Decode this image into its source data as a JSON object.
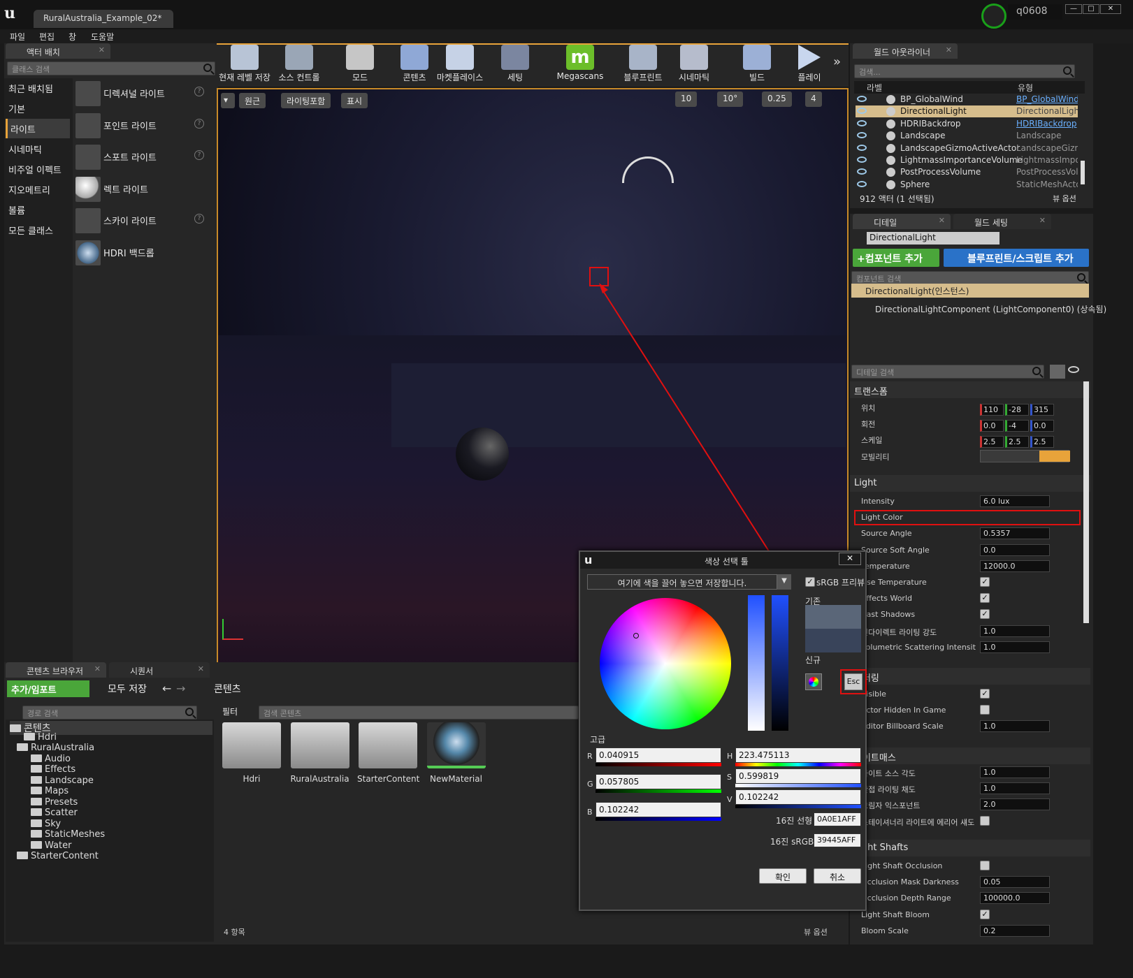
{
  "titlebar": {
    "tab": "RuralAustralia_Example_02*",
    "user": "q0608"
  },
  "menu": [
    "파일",
    "편집",
    "창",
    "도움말"
  ],
  "place_actors": {
    "tab": "액터 배치",
    "search_placeholder": "클래스 검색",
    "categories": [
      "최근 배치됨",
      "기본",
      "라이트",
      "시네마틱",
      "비주얼 이펙트",
      "지오메트리",
      "볼륨",
      "모든 클래스"
    ],
    "items": [
      "디렉셔널 라이트",
      "포인트 라이트",
      "스포트 라이트",
      "렉트 라이트",
      "스카이 라이트",
      "HDRI 백드롭"
    ]
  },
  "toolbar": [
    "현재 레벨 저장",
    "소스 컨트롤",
    "모드",
    "콘텐츠",
    "마켓플레이스",
    "세팅",
    "Megascans",
    "블루프린트",
    "시네마틱",
    "빌드",
    "플레이"
  ],
  "viewport": {
    "perspective": "원근",
    "lighting": "라이팅포함",
    "show": "표시",
    "grid": "10",
    "rot": "10°",
    "scale": "0.25",
    "cam": "4"
  },
  "outliner": {
    "tab": "월드 아웃라이너",
    "search_placeholder": "검색...",
    "col_label": "라벨",
    "col_type": "유형",
    "rows": [
      {
        "name": "BP_GlobalWind",
        "type": "BP_GlobalWind"
      },
      {
        "name": "DirectionalLight",
        "type": "DirectionalLight"
      },
      {
        "name": "HDRIBackdrop",
        "type": "HDRIBackdrop"
      },
      {
        "name": "Landscape",
        "type": "Landscape"
      },
      {
        "name": "LandscapeGizmoActiveActor",
        "type": "LandscapeGizmo"
      },
      {
        "name": "LightmassImportanceVolume",
        "type": "LightmassImporta"
      },
      {
        "name": "PostProcessVolume",
        "type": "PostProcessVolu"
      },
      {
        "name": "Sphere",
        "type": "StaticMeshActor"
      }
    ],
    "count": "912 액터 (1 선택됨)",
    "view_options": "뷰 옵션"
  },
  "details": {
    "tab": "디테일",
    "tab2": "월드 세팅",
    "actor_name": "DirectionalLight",
    "add_component": "+컴포넌트 추가",
    "add_bp": "블루프린트/스크립트 추가",
    "comp_search": "컴포넌트 검색",
    "instance": "DirectionalLight(인스턴스)",
    "component": "DirectionalLightComponent (LightComponent0) (상속됨)",
    "detail_search": "디테일 검색",
    "transform": "트랜스폼",
    "pos_label": "위치",
    "rot_label": "회전",
    "scale_label": "스케일",
    "mobility_label": "모빌리티",
    "pos": [
      "110",
      "-28",
      "315"
    ],
    "rot": [
      "0.0",
      "-4",
      "0.0"
    ],
    "scale": [
      "2.5",
      "2.5",
      "2.5"
    ],
    "light_section": "Light",
    "light_rows": [
      {
        "label": "Intensity",
        "value": "6.0 lux"
      },
      {
        "label": "Light Color",
        "value": ""
      },
      {
        "label": "Source Angle",
        "value": "0.5357"
      },
      {
        "label": "Source Soft Angle",
        "value": "0.0"
      },
      {
        "label": "Temperature",
        "value": "12000.0"
      },
      {
        "label": "Use Temperature",
        "value": ""
      },
      {
        "label": "Affects World",
        "value": ""
      },
      {
        "label": "Cast Shadows",
        "value": ""
      },
      {
        "label": "인다이렉트 라이팅 강도",
        "value": "1.0"
      },
      {
        "label": "Volumetric Scattering Intensity",
        "value": "1.0"
      }
    ],
    "render_section": "렌더링",
    "render_rows": [
      {
        "label": "Visible",
        "value": ""
      },
      {
        "label": "Actor Hidden In Game",
        "value": ""
      },
      {
        "label": "Editor Billboard Scale",
        "value": "1.0"
      }
    ],
    "lightmass_section": "라이트매스",
    "lightmass_rows": [
      {
        "label": "라이트 소스 각도",
        "value": "1.0"
      },
      {
        "label": "간접 라이팅 채도",
        "value": "1.0"
      },
      {
        "label": "그림자 익스포넌트",
        "value": "2.0"
      },
      {
        "label": "스테이셔너리 라이트에 에리어 섀도 사용",
        "value": ""
      }
    ],
    "shafts_section": "Light Shafts",
    "shafts_rows": [
      {
        "label": "Light Shaft Occlusion",
        "value": ""
      },
      {
        "label": "Occlusion Mask Darkness",
        "value": "0.05"
      },
      {
        "label": "Occlusion Depth Range",
        "value": "100000.0"
      },
      {
        "label": "Light Shaft Bloom",
        "value": ""
      },
      {
        "label": "Bloom Scale",
        "value": "0.2"
      }
    ]
  },
  "content_browser": {
    "tab": "콘텐츠 브라우저",
    "tab2": "시퀀서",
    "add_import": "추가/임포트",
    "save_all": "모두 저장",
    "path": "콘텐츠",
    "path_search": "경로 검색",
    "filter": "필터",
    "content_search": "검색 콘텐츠",
    "tree": [
      "콘텐츠",
      "Hdri",
      "RuralAustralia",
      "Audio",
      "Effects",
      "Landscape",
      "Maps",
      "Presets",
      "Scatter",
      "Sky",
      "StaticMeshes",
      "Water",
      "StarterContent"
    ],
    "items": [
      "Hdri",
      "RuralAustralia",
      "StarterContent",
      "NewMaterial"
    ],
    "count": "4 항목",
    "view_options": "뷰 옵션"
  },
  "color_picker": {
    "title": "색상 선택 툴",
    "drop_hint": "여기에 색을 끌어 놓으면 저장합니다.",
    "srgb_preview": "sRGB 프리뷰",
    "old_label": "기존",
    "new_label": "신규",
    "esc": "Esc",
    "advanced": "고급",
    "r": "0.040915",
    "g": "0.057805",
    "b": "0.102242",
    "h": "223.475113",
    "s": "0.599819",
    "v": "0.102242",
    "hex_linear_label": "16진 선형",
    "hex_linear": "0A0E1AFF",
    "hex_srgb_label": "16진 sRGB",
    "hex_srgb": "39445AFF",
    "ok": "확인",
    "cancel": "취소",
    "old_color": "#5a6678",
    "new_color": "#39445a"
  }
}
